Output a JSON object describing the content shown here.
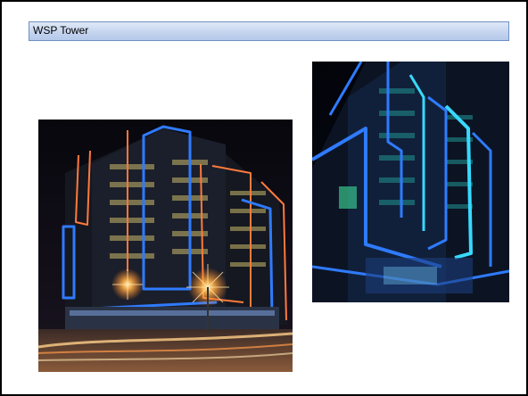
{
  "slide": {
    "title": "WSP Tower"
  },
  "images": [
    {
      "name": "tower-night-street-photo",
      "description_icon": "building-photo-icon"
    },
    {
      "name": "tower-facade-closeup-photo",
      "description_icon": "building-photo-icon"
    }
  ],
  "colors": {
    "title_bar_top": "#dfe8f7",
    "title_bar_bottom": "#b4c8ea",
    "title_bar_border": "#6f8fc4",
    "neon_blue": "#2f7bff",
    "neon_cyan": "#38d9ff",
    "neon_orange": "#ff7a3c",
    "night_sky": "#05060c"
  }
}
